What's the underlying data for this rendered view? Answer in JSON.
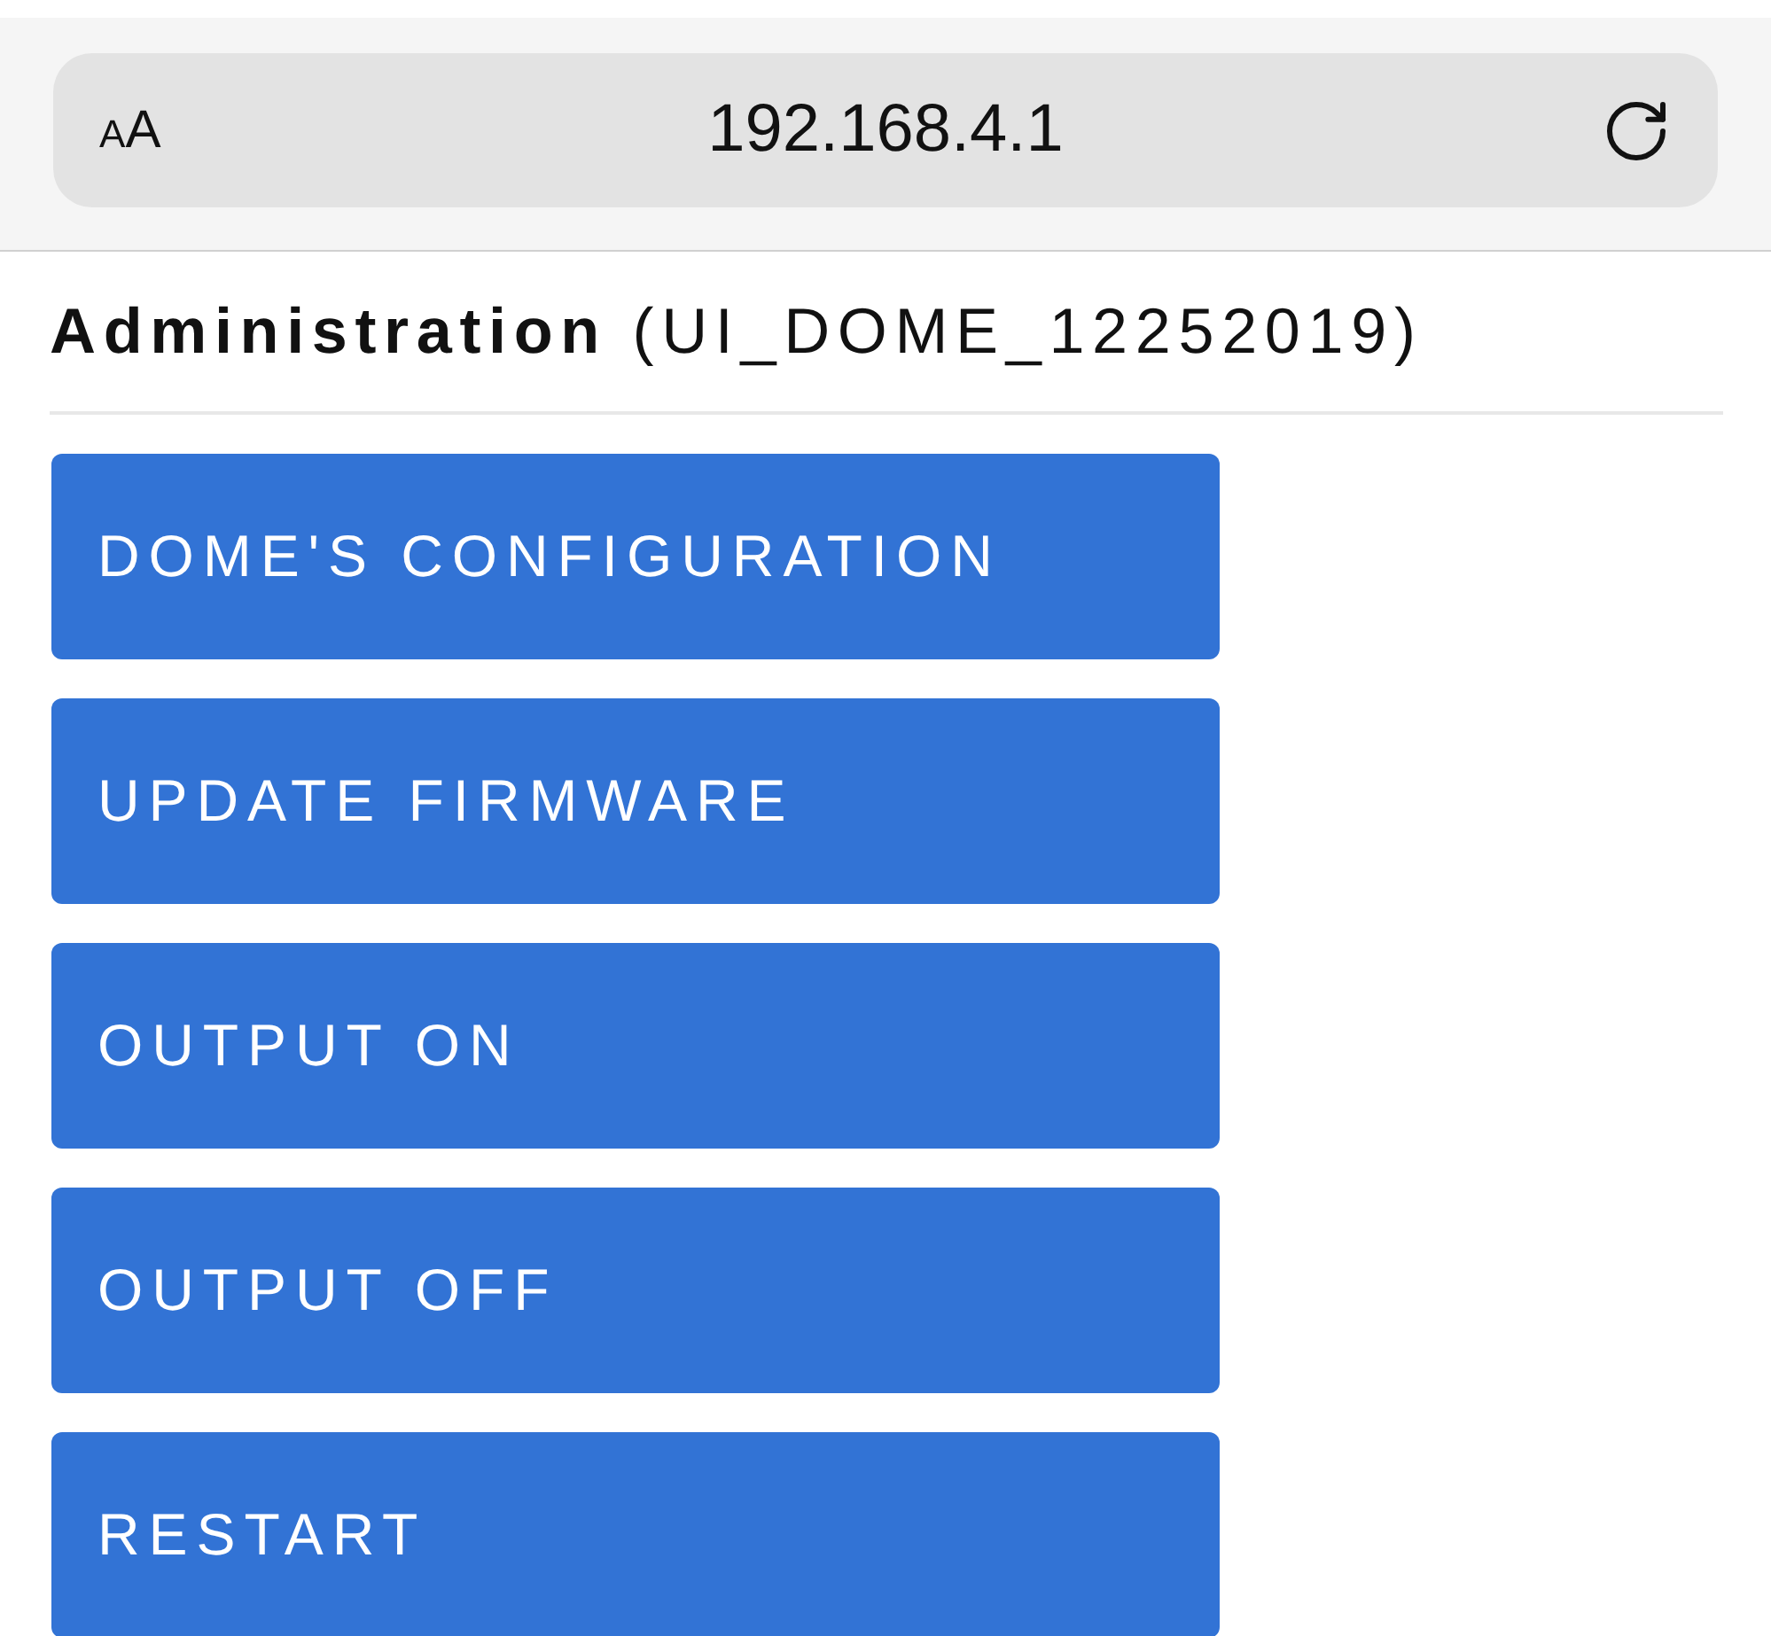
{
  "browser": {
    "text_size_label": "AA",
    "url": "192.168.4.1"
  },
  "heading": "**Administration** (UI_DOME_12252019)",
  "buttons": [
    "DOME'S CONFIGURATION",
    "UPDATE FIRMWARE",
    "OUTPUT ON",
    "OUTPUT OFF",
    "RESTART"
  ]
}
